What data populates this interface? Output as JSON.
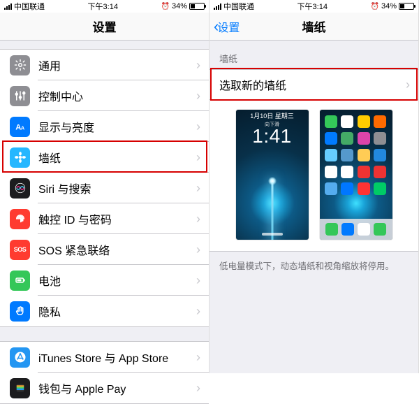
{
  "status": {
    "carrier": "中国联通",
    "time": "下午3:14",
    "battery_pct": "34%"
  },
  "left": {
    "title": "设置",
    "groups": [
      [
        {
          "key": "general",
          "label": "通用",
          "bg": "bg-gray",
          "icon": "gear"
        },
        {
          "key": "control-center",
          "label": "控制中心",
          "bg": "bg-gray2",
          "icon": "sliders"
        },
        {
          "key": "display",
          "label": "显示与亮度",
          "bg": "bg-blue",
          "icon": "text-aa"
        },
        {
          "key": "wallpaper",
          "label": "墙纸",
          "bg": "bg-cyan",
          "icon": "flower",
          "highlighted": true
        },
        {
          "key": "siri",
          "label": "Siri 与搜索",
          "bg": "bg-black",
          "icon": "siri"
        },
        {
          "key": "touchid",
          "label": "触控 ID 与密码",
          "bg": "bg-red",
          "icon": "fingerprint"
        },
        {
          "key": "sos",
          "label": "SOS 紧急联络",
          "bg": "bg-sos",
          "icon": "sos"
        },
        {
          "key": "battery",
          "label": "电池",
          "bg": "bg-green",
          "icon": "battery"
        },
        {
          "key": "privacy",
          "label": "隐私",
          "bg": "bg-blue",
          "icon": "hand"
        }
      ],
      [
        {
          "key": "itunes",
          "label": "iTunes Store 与 App Store",
          "bg": "bg-blue2",
          "icon": "appstore"
        },
        {
          "key": "wallet",
          "label": "钱包与 Apple Pay",
          "bg": "bg-wallet",
          "icon": "wallet"
        }
      ]
    ]
  },
  "right": {
    "back_label": "设置",
    "title": "墙纸",
    "section_label": "墙纸",
    "choose_label": "选取新的墙纸",
    "lock_clock": "1:41",
    "lock_date": "1月10日 星期三",
    "lock_sub": "向下滑",
    "footer": "低电量模式下，动态墙纸和视角缩放将停用。",
    "colors": {
      "home_apps": [
        "#34c759",
        "#fff",
        "#ffcc00",
        "#ff6a00",
        "#007aff",
        "#4a6",
        "#d4a",
        "#8e8e93",
        "#6cf",
        "#59c",
        "#fc5",
        "#28d",
        "#fff",
        "#fff",
        "#e33",
        "#e33",
        "#55acee",
        "#07f",
        "#f33",
        "#0c6"
      ],
      "dock": [
        "#34c759",
        "#007aff",
        "#ffffff",
        "#34c759"
      ]
    }
  }
}
